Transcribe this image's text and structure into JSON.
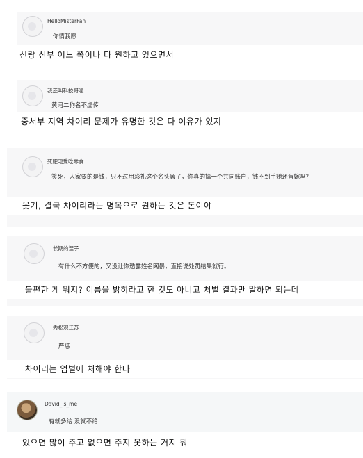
{
  "comments": [
    {
      "username": "HelloMisterFan",
      "text": "你情我愿",
      "translation": "신랑 신부 어느 쪽이나 다 원하고 있으면서"
    },
    {
      "username": "我还叫科技哥呢",
      "text": "黄河二狗名不虚传",
      "translation": "중서부 지역 차이리 문제가 유명한 것은 다 이유가 있지"
    },
    {
      "username": "死肥宅爱吃零食",
      "text": "笑死，人家要的是钱，只不过用彩礼这个名头罢了，你真的搞一个共同账户，钱不到手她还肯嫁吗？",
      "translation": "웃겨, 결국 차이리라는 명목으로 원하는 것은 돈이야"
    },
    {
      "username": "长期的涅子",
      "text": "有什么不方便的，又没让你透露姓名网暴，直接说处罚结果就行。",
      "translation": "불편한 게 뭐지? 이름을 밝히라고 한 것도 아니고 처벌 결과만 말하면 되는데"
    },
    {
      "username": "秀松观江苏",
      "text": "严惩",
      "translation": "차이리는 엄벌에 처해야 한다"
    },
    {
      "username": "David_is_me",
      "text": "有就多给 没就不给",
      "translation": "있으면 많이 주고 없으면 주지 못하는 거지 뭐"
    }
  ]
}
